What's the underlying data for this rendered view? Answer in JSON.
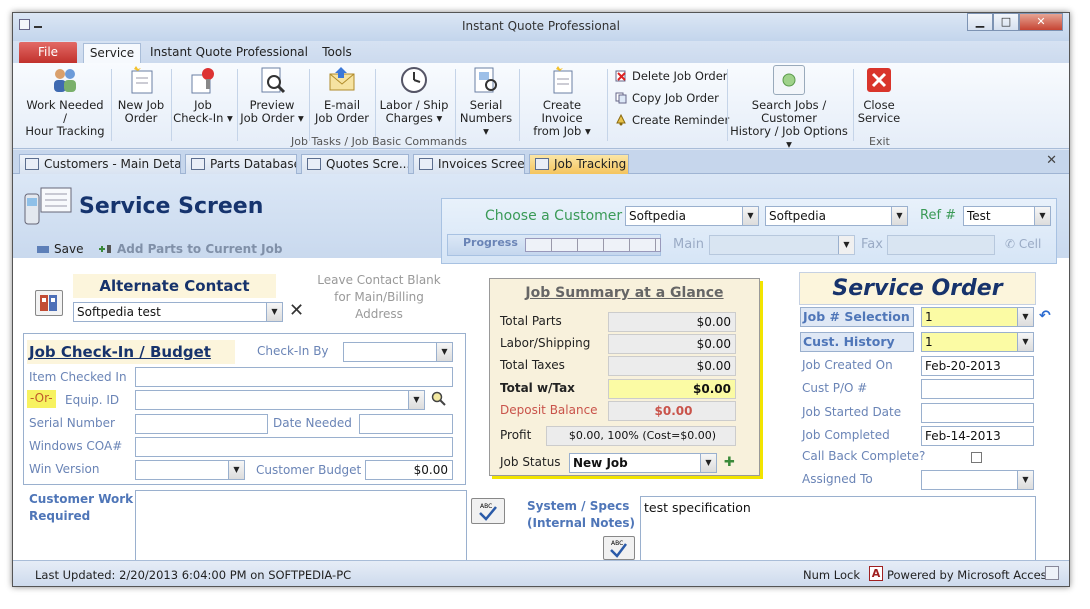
{
  "window": {
    "title": "Instant Quote Professional"
  },
  "ribbon_tabs": {
    "file": "File",
    "service": "Service",
    "iqp": "Instant Quote Professional",
    "tools": "Tools"
  },
  "ribbon": {
    "work_needed": "Work Needed /",
    "work_needed2": "Hour Tracking",
    "new_job": "New Job",
    "new_job2": "Order",
    "job_checkin": "Job",
    "job_checkin2": "Check-In",
    "preview": "Preview",
    "preview2": "Job Order",
    "email": "E-mail",
    "email2": "Job Order",
    "labor": "Labor / Ship",
    "labor2": "Charges",
    "serial": "Serial",
    "serial2": "Numbers",
    "create_invoice": "Create Invoice",
    "create_invoice2": "from Job",
    "delete_order": "Delete Job Order",
    "copy_order": "Copy Job Order",
    "create_reminder": "Create Reminder",
    "search_jobs": "Search Jobs / Customer",
    "search_jobs2": "History / Job Options",
    "close": "Close",
    "close2": "Service",
    "group_tasks": "Job Tasks / Job Basic Commands",
    "group_exit": "Exit"
  },
  "doc_tabs": [
    "Customers - Main Details",
    "Parts Database",
    "Quotes Scre...",
    "Invoices Screen",
    "Job Tracking"
  ],
  "header": {
    "title": "Service Screen",
    "save": "Save",
    "add_parts": "Add Parts to Current Job",
    "choose_customer": "Choose a Customer",
    "customer1": "Softpedia",
    "customer2": "Softpedia",
    "ref_label": "Ref #",
    "ref_value": "Test",
    "progress": "Progress",
    "main": "Main",
    "fax": "Fax",
    "cell": "Cell"
  },
  "alternate": {
    "title": "Alternate Contact",
    "value": "Softpedia test",
    "hint": "Leave Contact Blank for Main/Billing Address"
  },
  "checkin": {
    "title": "Job Check-In / Budget",
    "checkin_by": "Check-In By",
    "item_checked": "Item Checked In",
    "or": "-Or-",
    "equip_id": "Equip. ID",
    "serial": "Serial Number",
    "date_needed": "Date Needed",
    "windows_coa": "Windows COA#",
    "win_version": "Win Version",
    "customer_budget": "Customer Budget",
    "budget_value": "$0.00"
  },
  "work_required": {
    "label1": "Customer Work",
    "label2": "Required"
  },
  "summary": {
    "title": "Job Summary at a Glance",
    "total_parts": "Total Parts",
    "total_parts_val": "$0.00",
    "labor": "Labor/Shipping",
    "labor_val": "$0.00",
    "taxes": "Total Taxes",
    "taxes_val": "$0.00",
    "total": "Total w/Tax",
    "total_val": "$0.00",
    "deposit": "Deposit Balance",
    "deposit_val": "$0.00",
    "profit": "Profit",
    "profit_val": "$0.00, 100% (Cost=$0.00)",
    "status": "Job Status",
    "status_val": "New Job"
  },
  "specs": {
    "label1": "System / Specs",
    "label2": "(Internal Notes)",
    "value": "test specification"
  },
  "order": {
    "title": "Service Order",
    "job_sel": "Job  # Selection",
    "job_sel_val": "1",
    "cust_hist": "Cust. History",
    "cust_hist_val": "1",
    "created": "Job Created On",
    "created_val": "Feb-20-2013",
    "po": "Cust P/O #",
    "started": "Job Started Date",
    "completed": "Job Completed",
    "completed_val": "Feb-14-2013",
    "callback": "Call Back Complete?",
    "assigned": "Assigned To"
  },
  "status": {
    "updated": "Last Updated: 2/20/2013 6:04:00 PM on SOFTPEDIA-PC",
    "numlock": "Num Lock",
    "powered": "Powered by Microsoft Access"
  }
}
